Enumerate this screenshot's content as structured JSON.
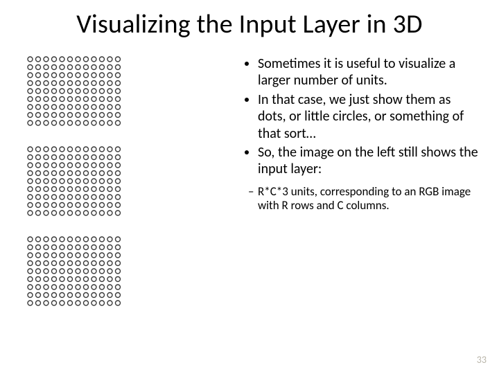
{
  "title": "Visualizing the Input Layer in 3D",
  "bullets": {
    "b1": "Sometimes it is useful to visualize a larger number of units.",
    "b2": "In that case, we just show them as dots, or little circles, or something of that sort…",
    "b3": "So, the image on the left still shows the input layer:",
    "sub1": "R*C*3 units, corresponding to an RGB image with R rows and C columns."
  },
  "diagram": {
    "blocks": 3,
    "rows": 9,
    "cols": 12,
    "circle_radius": 3.5,
    "spacing": 11.5,
    "block_gap": 27,
    "stroke": "#3a3a3a",
    "stroke_width": 1.4
  },
  "page_number": "33"
}
